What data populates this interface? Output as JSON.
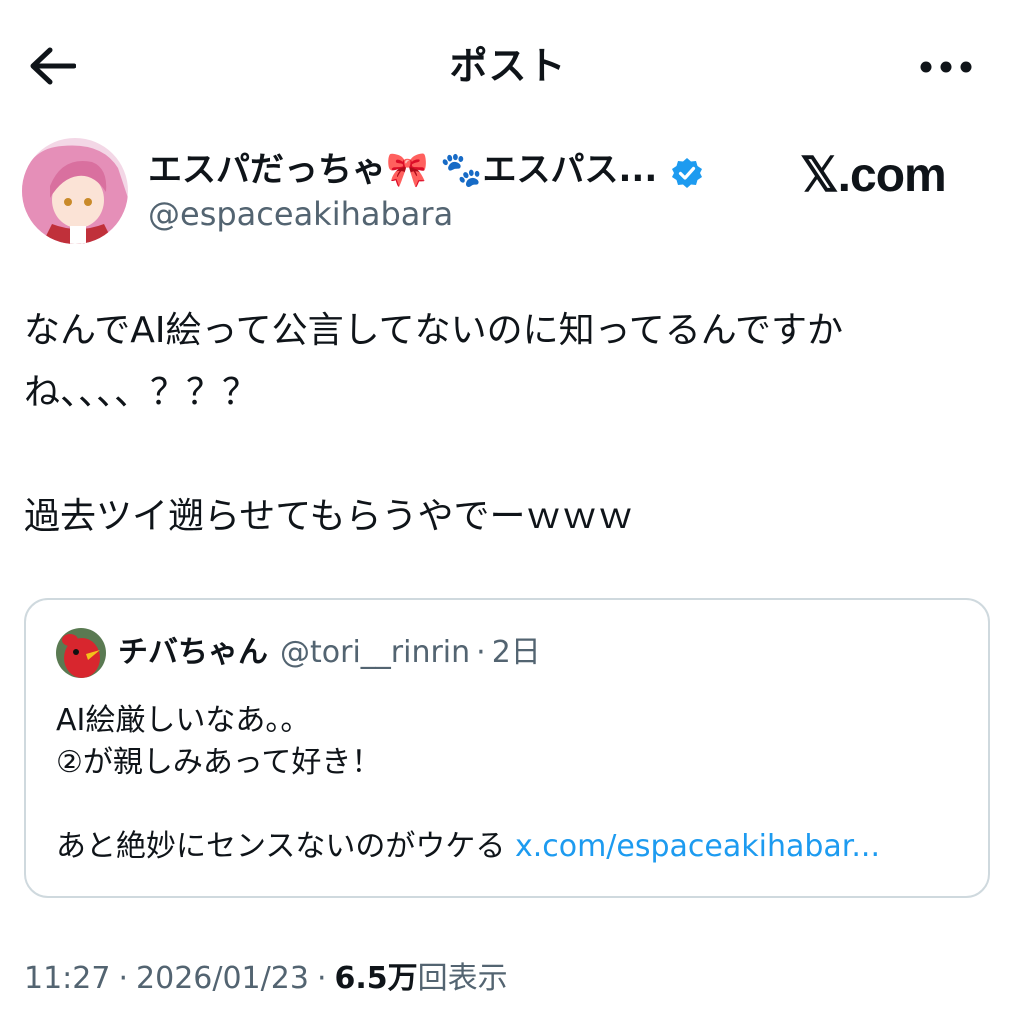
{
  "header": {
    "title": "ポスト"
  },
  "author": {
    "display_name": "エスパだっちゃ🎀 🐾エスパス...",
    "handle": "@espaceakihabara"
  },
  "watermark": "𝕏.com",
  "post": {
    "line1": "なんでAI絵って公言してないのに知ってるんですか",
    "line2": "ね、、、、？？？",
    "line3": "過去ツイ遡らせてもらうやでーｗｗｗ"
  },
  "quote": {
    "name": "チバちゃん",
    "handle": "@tori__rinrin",
    "dot": "·",
    "time": "2日",
    "line1": "AI絵厳しいなあ。。",
    "line2": "②が親しみあって好き！",
    "line3": "あと絶妙にセンスないのがウケる ",
    "link": "x.com/espaceakihabar..."
  },
  "meta": {
    "time": "11:27",
    "sep": "·",
    "date": "2026/01/23",
    "views_count": "6.5万",
    "views_label": "回表示"
  },
  "colors": {
    "text": "#0f1419",
    "secondary": "#536471",
    "link": "#1d9bf0",
    "border": "#cfd9de",
    "verified": "#1d9bf0"
  },
  "icons": {
    "back": "arrow-left-icon",
    "more": "more-horizontal-icon",
    "verified": "verified-badge-icon"
  }
}
